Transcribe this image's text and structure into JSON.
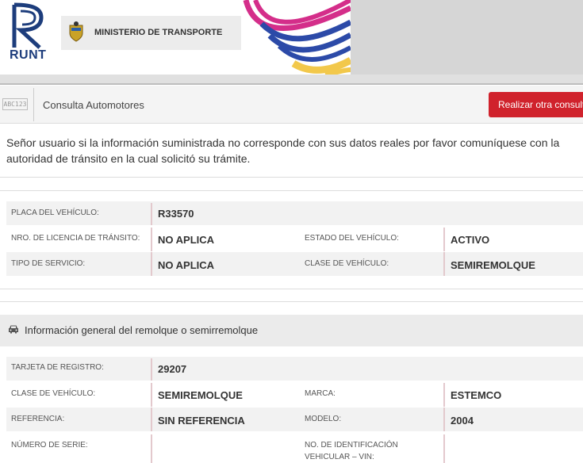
{
  "header": {
    "logo_text": "RUNT",
    "ministry": "MINISTERIO DE TRANSPORTE",
    "colors": {
      "brand_blue": "#1d3d7c",
      "accent_red": "#d0222c"
    }
  },
  "titlebar": {
    "icon_text": "ABC123",
    "title": "Consulta Automotores",
    "button": "Realizar otra consulta"
  },
  "notice": "Señor usuario si la información suministrada no corresponde con sus datos reales por favor comuníquese con la autoridad de tránsito en la cual solicitó su trámite.",
  "vehicle": {
    "placa_label": "PLACA DEL VEHÍCULO:",
    "placa": "R33570",
    "licencia_label": "NRO. DE LICENCIA DE TRÁNSITO:",
    "licencia": "NO APLICA",
    "estado_label": "ESTADO DEL VEHÍCULO:",
    "estado": "ACTIVO",
    "servicio_label": "TIPO DE SERVICIO:",
    "servicio": "NO APLICA",
    "clase_label": "CLASE DE VEHÍCULO:",
    "clase": "SEMIREMOLQUE"
  },
  "section": {
    "title": "Información general del remolque o semirremolque",
    "icon": "car-icon"
  },
  "trailer": {
    "tarjeta_label": "TARJETA DE REGISTRO:",
    "tarjeta": "29207",
    "clase_label": "CLASE DE VEHÍCULO:",
    "clase": "SEMIREMOLQUE",
    "marca_label": "MARCA:",
    "marca": "ESTEMCO",
    "referencia_label": "REFERENCIA:",
    "referencia": "SIN REFERENCIA",
    "modelo_label": "MODELO:",
    "modelo": "2004",
    "serie_label": "NÚMERO DE SERIE:",
    "serie": "",
    "vin_label_1": "NO. DE IDENTIFICACIÓN",
    "vin_label_2": "VEHICULAR – VIN:",
    "vin": ""
  }
}
